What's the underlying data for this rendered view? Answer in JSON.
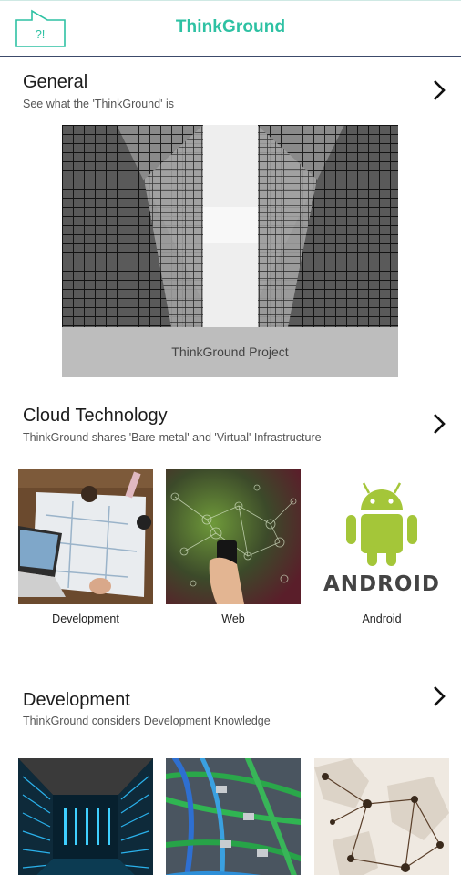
{
  "header": {
    "logo_text": "?!",
    "title": "ThinkGround"
  },
  "sections": [
    {
      "title": "General",
      "subtitle": "See what the 'ThinkGround' is",
      "hero_caption": "ThinkGround Project"
    },
    {
      "title": "Cloud Technology",
      "subtitle": "ThinkGround shares 'Bare-metal' and 'Virtual' Infrastructure",
      "cards": [
        {
          "label": "Development"
        },
        {
          "label": "Web"
        },
        {
          "label": "Android",
          "logo_text": "ANDROID"
        }
      ]
    },
    {
      "title": "Development",
      "subtitle": "ThinkGround considers Development Knowledge",
      "cards": [
        {
          "label": ""
        },
        {
          "label": ""
        },
        {
          "label": ""
        }
      ]
    }
  ],
  "colors": {
    "accent": "#2ec1a3",
    "header_rule": "#3c4a6a",
    "android_green": "#a4c639",
    "caption_bg": "#bdbdbd"
  }
}
